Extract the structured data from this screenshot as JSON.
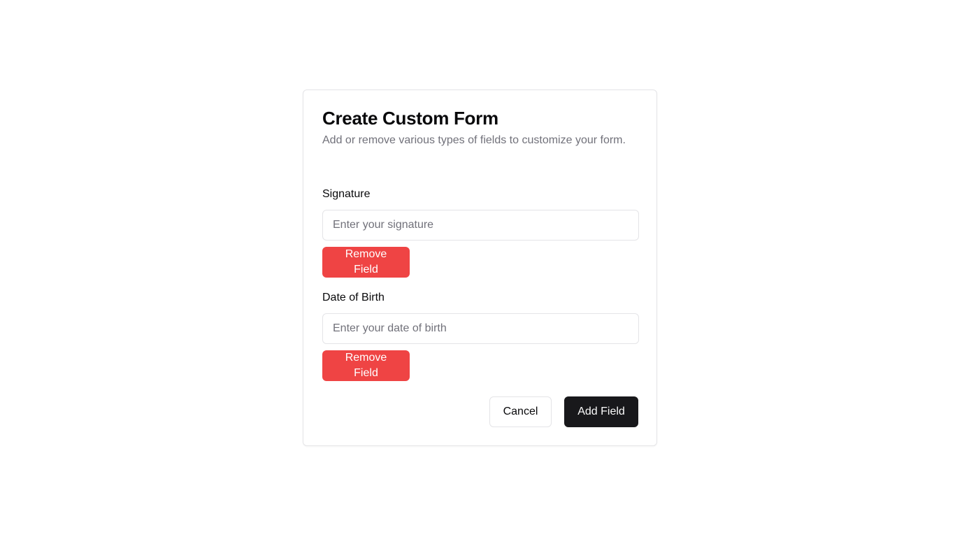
{
  "form": {
    "title": "Create Custom Form",
    "subtitle": "Add or remove various types of fields to customize your form.",
    "fields": [
      {
        "label": "Signature",
        "placeholder": "Enter your signature",
        "value": "",
        "remove_label": "Remove Field"
      },
      {
        "label": "Date of Birth",
        "placeholder": "Enter your date of birth",
        "value": "",
        "remove_label": "Remove Field"
      }
    ],
    "actions": {
      "cancel_label": "Cancel",
      "add_label": "Add Field"
    }
  },
  "colors": {
    "remove": "#ef4444",
    "primary": "#18181b",
    "muted_text": "#71717a",
    "border": "#e4e4e7"
  }
}
